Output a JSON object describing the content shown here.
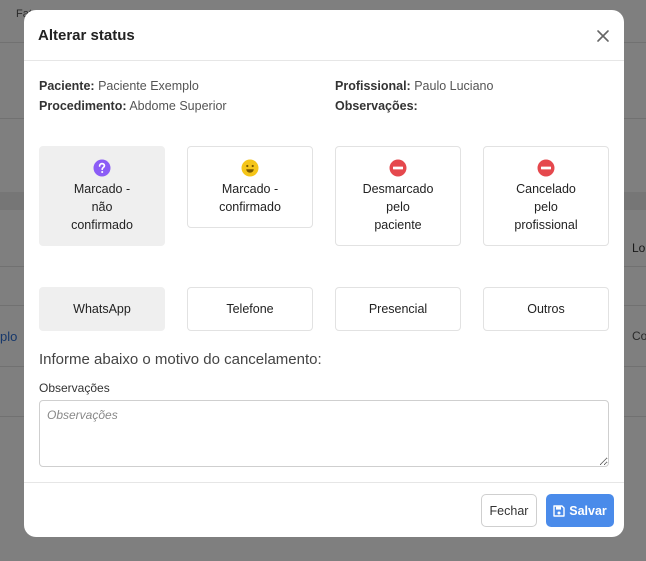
{
  "background": {
    "top_text": "Fat",
    "left_link": "plo",
    "right_label_1": "Lo",
    "right_label_2": "Co"
  },
  "modal": {
    "title": "Alterar status",
    "patient_label": "Paciente:",
    "patient_value": "Paciente Exemplo",
    "procedure_label": "Procedimento:",
    "procedure_value": "Abdome Superior",
    "professional_label": "Profissional:",
    "professional_value": "Paulo Luciano",
    "notes_label": "Observações:",
    "notes_value": ""
  },
  "status_options": [
    {
      "line1": "Marcado -",
      "line2": "não",
      "line3": "confirmado",
      "icon": "question-icon",
      "color": "#8b5cf6",
      "selected": true
    },
    {
      "line1": "Marcado -",
      "line2": "confirmado",
      "line3": "",
      "icon": "smile-icon",
      "color": "#f5c518",
      "selected": false
    },
    {
      "line1": "Desmarcado",
      "line2": "pelo",
      "line3": "paciente",
      "icon": "no-entry-icon",
      "color": "#e5484d",
      "selected": false
    },
    {
      "line1": "Cancelado",
      "line2": "pelo",
      "line3": "profissional",
      "icon": "no-entry-icon",
      "color": "#e5484d",
      "selected": false
    }
  ],
  "channels": [
    {
      "label": "WhatsApp",
      "selected": true
    },
    {
      "label": "Telefone",
      "selected": false
    },
    {
      "label": "Presencial",
      "selected": false
    },
    {
      "label": "Outros",
      "selected": false
    }
  ],
  "reason": {
    "title": "Informe abaixo o motivo do cancelamento:",
    "field_label": "Observações",
    "placeholder": "Observações",
    "value": ""
  },
  "footer": {
    "close_label": "Fechar",
    "save_label": "Salvar"
  },
  "colors": {
    "primary": "#4a8bea",
    "selected_tile": "#efefef"
  }
}
